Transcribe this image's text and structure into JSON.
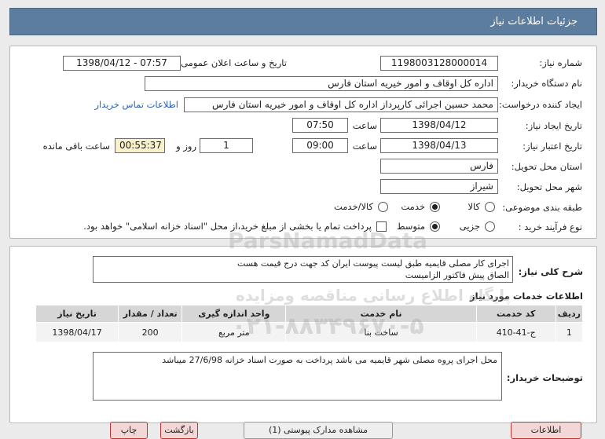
{
  "header": {
    "title": "جزئیات اطلاعات نیاز"
  },
  "form": {
    "need_number_label": "شماره نیاز:",
    "need_number": "1198003128000014",
    "announce_label": "تاریخ و ساعت اعلان عمومی:",
    "announce_value": "1398/04/12 - 07:57",
    "buyer_org_label": "نام دستگاه خریدار:",
    "buyer_org": "اداره کل اوقاف و امور خیریه استان فارس",
    "creator_label": "ایجاد کننده درخواست:",
    "creator": "محمد حسین اجرائی کارپرداز اداره کل اوقاف و امور خیریه استان فارس",
    "contact_link": "اطلاعات تماس خریدار",
    "create_date_label": "تاریخ ایجاد نیاز:",
    "create_date": "1398/04/12",
    "time_label": "ساعت",
    "create_time": "07:50",
    "valid_date_label": "تاریخ اعتبار نیاز:",
    "valid_date": "1398/04/13",
    "valid_time": "09:00",
    "day_label": "روز و",
    "days": "1",
    "remaining": "00:55:37",
    "remaining_label": "ساعت باقی مانده",
    "province_label": "استان محل تحویل:",
    "province": "فارس",
    "city_label": "شهر محل تحویل:",
    "city": "شیراز",
    "category_label": "طبقه بندی موضوعی:",
    "category_options": [
      "کالا",
      "خدمت",
      "کالا/خدمت"
    ],
    "category_selected": "خدمت",
    "process_label": "نوع فرآیند خرید :",
    "process_options": [
      "جزیی",
      "متوسط"
    ],
    "process_selected": "متوسط",
    "payment_note": "پرداخت تمام یا بخشی از مبلغ خرید،از محل \"اسناد خزانه اسلامی\" خواهد بود."
  },
  "summary": {
    "label": "شرح کلی نیاز:",
    "line1": "اجرای کار مصلی قایمیه طبق لیست پیوست ایران کد جهت درج قیمت هست",
    "line2": "الصاق پیش فاکتور الزامیست"
  },
  "services": {
    "title": "اطلاعات خدمات مورد نیاز",
    "columns": [
      "ردیف",
      "کد خدمت",
      "نام خدمت",
      "واحد اندازه گیری",
      "تعداد / مقدار",
      "تاریخ نیاز"
    ],
    "rows": [
      [
        "1",
        "ج-41-410",
        "ساخت بنا",
        "متر مربع",
        "200",
        "1398/04/17"
      ]
    ]
  },
  "buyer_notes": {
    "label": "توضیحات خریدار:",
    "text": "محل اجرای پروه مصلی شهر قایمیه می باشد پرداخت به صورت اسناد خزانه 27/6/98 میباشد"
  },
  "footer": {
    "buttons": [
      "اطلاعات",
      "مشاهده مدارک پیوستی (1)",
      "بازگشت",
      "چاپ"
    ]
  },
  "watermark": {
    "line1": "ParsNamadData",
    "line2": "پایگاه اطلاع رسانی مناقصه ومزایده",
    "line3": "۰۲۱-۸۸۳۴۹۶۷۰-۵"
  }
}
